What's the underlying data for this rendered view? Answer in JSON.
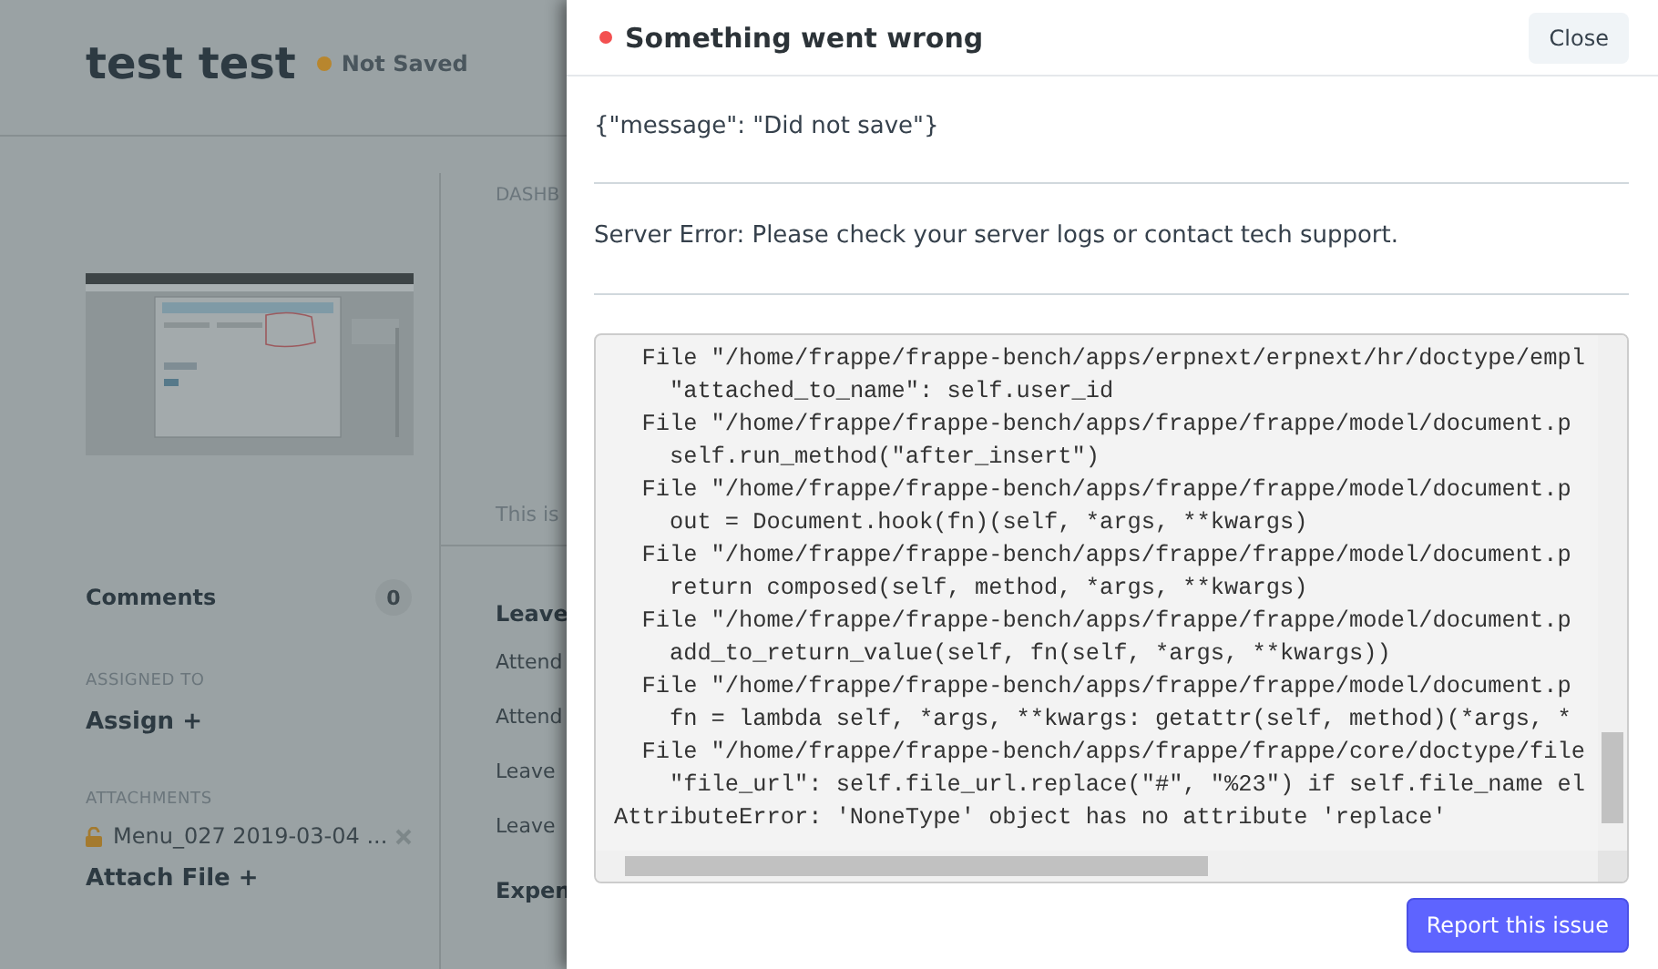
{
  "page": {
    "title": "test test",
    "status": "Not Saved"
  },
  "sidebar": {
    "comments": {
      "label": "Comments",
      "count": "0"
    },
    "assigned": {
      "heading": "ASSIGNED TO",
      "action": "Assign +"
    },
    "attachments": {
      "heading": "ATTACHMENTS",
      "files": [
        "Menu_027 2019-03-04 ..."
      ],
      "action": "Attach File +"
    }
  },
  "main": {
    "heading": "DASHB",
    "note": "This is",
    "section_title": "Leave",
    "items": [
      "Attend",
      "Attend",
      "Leave",
      "Leave"
    ],
    "next_section": "Expen"
  },
  "dialog": {
    "title": "Something went wrong",
    "close": "Close",
    "message": "{\"message\": \"Did not save\"}",
    "server_error": "Server Error: Please check your server logs or contact tech support.",
    "traceback": [
      {
        "kind": "file",
        "text": "File \"/home/frappe/frappe-bench/apps/erpnext/erpnext/hr/doctype/empl"
      },
      {
        "kind": "code",
        "text": "\"attached_to_name\": self.user_id"
      },
      {
        "kind": "file",
        "text": "File \"/home/frappe/frappe-bench/apps/frappe/frappe/model/document.p"
      },
      {
        "kind": "code",
        "text": "self.run_method(\"after_insert\")"
      },
      {
        "kind": "file",
        "text": "File \"/home/frappe/frappe-bench/apps/frappe/frappe/model/document.p"
      },
      {
        "kind": "code",
        "text": "out = Document.hook(fn)(self, *args, **kwargs)"
      },
      {
        "kind": "file",
        "text": "File \"/home/frappe/frappe-bench/apps/frappe/frappe/model/document.p"
      },
      {
        "kind": "code",
        "text": "return composed(self, method, *args, **kwargs)"
      },
      {
        "kind": "file",
        "text": "File \"/home/frappe/frappe-bench/apps/frappe/frappe/model/document.p"
      },
      {
        "kind": "code",
        "text": "add_to_return_value(self, fn(self, *args, **kwargs))"
      },
      {
        "kind": "file",
        "text": "File \"/home/frappe/frappe-bench/apps/frappe/frappe/model/document.p"
      },
      {
        "kind": "code",
        "text": "fn = lambda self, *args, **kwargs: getattr(self, method)(*args, *"
      },
      {
        "kind": "file",
        "text": "File \"/home/frappe/frappe-bench/apps/frappe/frappe/core/doctype/file"
      },
      {
        "kind": "code",
        "text": "\"file_url\": self.file_url.replace(\"#\", \"%23\") if self.file_name el"
      },
      {
        "kind": "error",
        "text": "AttributeError: 'NoneType' object has no attribute 'replace'"
      }
    ],
    "report": "Report this issue"
  }
}
